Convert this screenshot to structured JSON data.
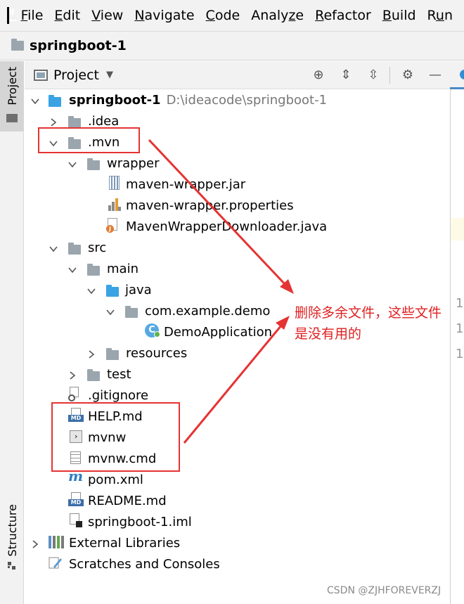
{
  "menu": {
    "items": [
      {
        "pre": "",
        "ul": "F",
        "post": "ile"
      },
      {
        "pre": "",
        "ul": "E",
        "post": "dit"
      },
      {
        "pre": "",
        "ul": "V",
        "post": "iew"
      },
      {
        "pre": "",
        "ul": "N",
        "post": "avigate"
      },
      {
        "pre": "",
        "ul": "C",
        "post": "ode"
      },
      {
        "pre": "Analy",
        "ul": "z",
        "post": "e"
      },
      {
        "pre": "",
        "ul": "R",
        "post": "efactor"
      },
      {
        "pre": "",
        "ul": "B",
        "post": "uild"
      },
      {
        "pre": "R",
        "ul": "u",
        "post": "n"
      }
    ]
  },
  "breadcrumb": {
    "title": "springboot-1"
  },
  "left_strip": {
    "project_tab": "Project",
    "structure_tab": "Structure"
  },
  "panel": {
    "title": "Project",
    "dropdown": "▼",
    "buttons": {
      "locate": "⊕",
      "expand": "⇕",
      "collapse": "⇳",
      "settings": "⚙",
      "hide": "—"
    }
  },
  "tree": {
    "root": {
      "label": "springboot-1",
      "path": "D:\\ideacode\\springboot-1"
    },
    "idea": ".idea",
    "mvn": ".mvn",
    "wrapper": "wrapper",
    "maven_wrapper_jar": "maven-wrapper.jar",
    "maven_wrapper_properties": "maven-wrapper.properties",
    "maven_wrapper_downloader": "MavenWrapperDownloader.java",
    "src": "src",
    "main": "main",
    "java": "java",
    "package": "com.example.demo",
    "demo_application": "DemoApplication",
    "resources": "resources",
    "test": "test",
    "gitignore": ".gitignore",
    "help_md": "HELP.md",
    "mvnw": "mvnw",
    "mvnw_cmd": "mvnw.cmd",
    "pom": "pom.xml",
    "readme": "README.md",
    "iml": "springboot-1.iml",
    "external_libraries": "External Libraries",
    "scratches": "Scratches and Consoles"
  },
  "editor": {
    "line_numbers": [
      "1",
      "1",
      "1"
    ]
  },
  "annotation": {
    "note": "删除多余文件，这些文件是没有用的",
    "color": "#e53333"
  },
  "watermark": "CSDN @ZJHFOREVERZJ"
}
